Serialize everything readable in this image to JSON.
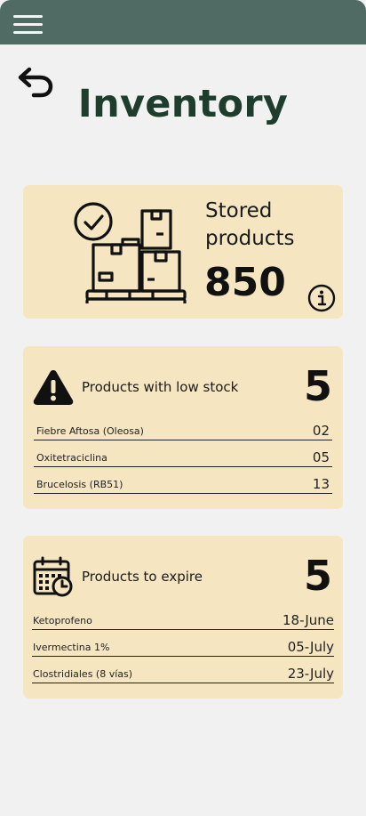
{
  "header": {
    "menu_icon": "hamburger-menu-icon",
    "bar_color": "#506b63"
  },
  "nav": {
    "back_icon": "undo-arrow-icon"
  },
  "page": {
    "title": "Inventory"
  },
  "stored": {
    "icon": "pallet-boxes-check-icon",
    "label": "Stored products",
    "count": "850",
    "info_icon": "info-icon"
  },
  "low_stock": {
    "icon": "warning-icon",
    "label": "Products with low stock",
    "count": "5",
    "items": [
      {
        "name": "Fiebre Aftosa (Oleosa)",
        "value": "02"
      },
      {
        "name": "Oxitetraciclina",
        "value": "05"
      },
      {
        "name": "Brucelosis (RB51)",
        "value": "13"
      }
    ]
  },
  "expire": {
    "icon": "calendar-clock-icon",
    "label": "Products to expire",
    "count": "5",
    "items": [
      {
        "name": "Ketoprofeno",
        "value": "18-June"
      },
      {
        "name": "Ivermectina 1%",
        "value": "05-July"
      },
      {
        "name": "Clostridiales (8 vías)",
        "value": "23-July"
      }
    ]
  },
  "colors": {
    "title": "#1f3d2c",
    "card": "#f6e5c1",
    "background": "#f1f1f1"
  }
}
